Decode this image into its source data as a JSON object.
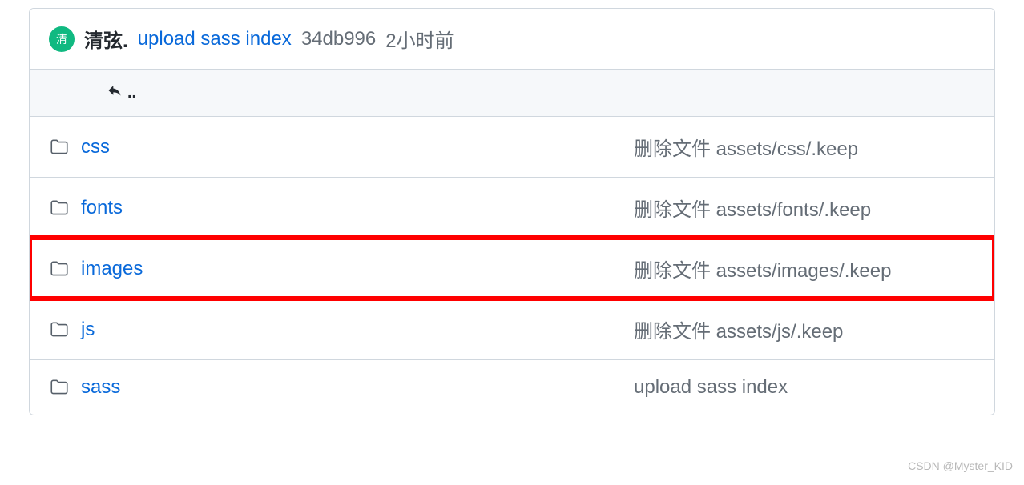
{
  "commit": {
    "avatar_text": "清",
    "author": "清弦.",
    "message": "upload sass index",
    "hash": "34db996",
    "time": "2小时前"
  },
  "parent_link": "..",
  "files": [
    {
      "name": "css",
      "message": "删除文件 assets/css/.keep",
      "highlighted": false
    },
    {
      "name": "fonts",
      "message": "删除文件 assets/fonts/.keep",
      "highlighted": false
    },
    {
      "name": "images",
      "message": "删除文件 assets/images/.keep",
      "highlighted": true
    },
    {
      "name": "js",
      "message": "删除文件 assets/js/.keep",
      "highlighted": false
    },
    {
      "name": "sass",
      "message": "upload sass index",
      "highlighted": false
    }
  ],
  "watermark": "CSDN @Myster_KID"
}
